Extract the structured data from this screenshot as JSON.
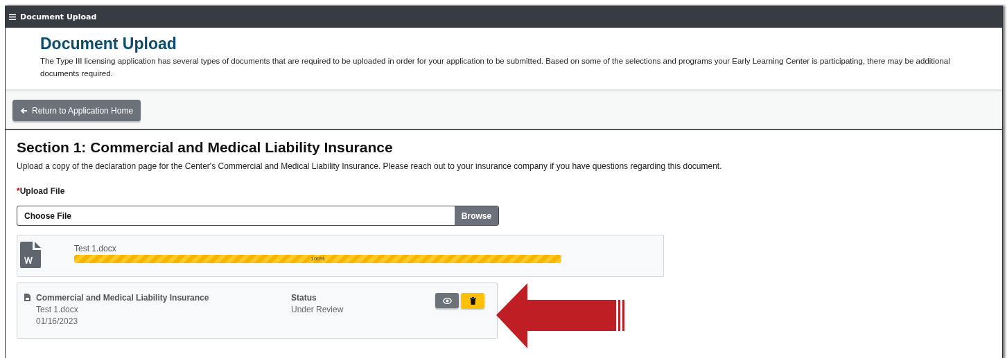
{
  "top_bar": {
    "title": "Document Upload"
  },
  "header": {
    "title": "Document Upload",
    "description": "The Type III licensing application has several types of documents that are required to be uploaded in order for your application to be submitted. Based on some of the selections and programs your Early Learning Center is participating, there may be additional documents required."
  },
  "return_button": {
    "label": "Return to Application Home"
  },
  "section": {
    "title": "Section 1: Commercial and Medical Liability Insurance",
    "description": "Upload a copy of the declaration page for the Center's Commercial and Medical Liability Insurance. Please reach out to your insurance company if you have questions regarding this document.",
    "upload_label": {
      "required_mark": "*",
      "text": "Upload File"
    },
    "file_input": {
      "value": "Choose File",
      "button": "Browse"
    },
    "uploads": [
      {
        "filename": "Test 1.docx",
        "level": 1,
        "reading": "100%"
      }
    ],
    "documents": [
      {
        "title": "Commercial and Medical Liability Insurance",
        "filename": "Test 1.docx",
        "date": "01/16/2023",
        "status_label": "Status",
        "status": "Under Review"
      }
    ]
  }
}
